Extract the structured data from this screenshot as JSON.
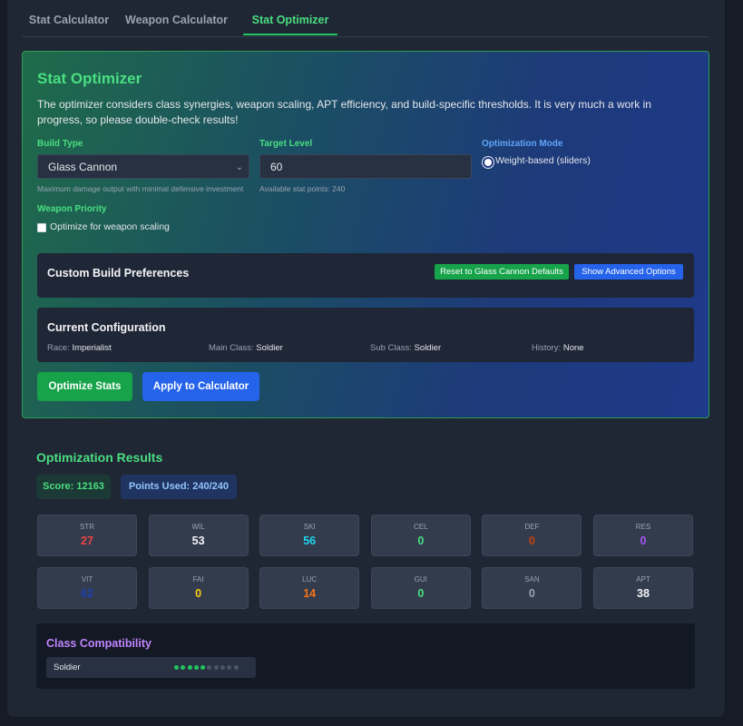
{
  "tabs": [
    {
      "label": "Stat Calculator",
      "active": false
    },
    {
      "label": "Weapon Calculator",
      "active": false
    },
    {
      "label": "Stat Optimizer",
      "active": true
    }
  ],
  "optimizer": {
    "title": "Stat Optimizer",
    "description": "The optimizer considers class synergies, weapon scaling, APT efficiency, and build-specific thresholds. It is very much a work in progress, so please double-check results!",
    "build_type": {
      "label": "Build Type",
      "value": "Glass Cannon",
      "help": "Maximum damage output with minimal defensive investment"
    },
    "target_level": {
      "label": "Target Level",
      "value": "60",
      "help": "Available stat points: 240"
    },
    "optimization_mode": {
      "label": "Optimization Mode",
      "option": "Weight-based (sliders)",
      "selected": true
    },
    "weapon_priority": {
      "label": "Weapon Priority",
      "checkbox_label": "Optimize for weapon scaling",
      "checked": false
    },
    "custom_prefs": {
      "title": "Custom Build Preferences",
      "reset_label": "Reset to Glass Cannon Defaults",
      "advanced_label": "Show Advanced Options"
    },
    "current_config": {
      "title": "Current Configuration",
      "race_label": "Race:",
      "race": "Imperialist",
      "main_label": "Main Class:",
      "main": "Soldier",
      "sub_label": "Sub Class:",
      "sub": "Soldier",
      "history_label": "History:",
      "history": "None"
    },
    "optimize_label": "Optimize Stats",
    "apply_label": "Apply to Calculator"
  },
  "results": {
    "title": "Optimization Results",
    "score": "Score: 12163",
    "points": "Points Used: 240/240",
    "stats": [
      {
        "name": "STR",
        "value": "27",
        "color": "#ef4444"
      },
      {
        "name": "WIL",
        "value": "53",
        "color": "#f3f4f6"
      },
      {
        "name": "SKI",
        "value": "56",
        "color": "#22d3ee"
      },
      {
        "name": "CEL",
        "value": "0",
        "color": "#4ade80"
      },
      {
        "name": "DEF",
        "value": "0",
        "color": "#c2410c"
      },
      {
        "name": "RES",
        "value": "0",
        "color": "#a855f7"
      },
      {
        "name": "VIT",
        "value": "62",
        "color": "#1e40af"
      },
      {
        "name": "FAI",
        "value": "0",
        "color": "#facc15"
      },
      {
        "name": "LUC",
        "value": "14",
        "color": "#f97316"
      },
      {
        "name": "GUI",
        "value": "0",
        "color": "#4ade80"
      },
      {
        "name": "SAN",
        "value": "0",
        "color": "#9ca3af"
      },
      {
        "name": "APT",
        "value": "38",
        "color": "#f3f4f6"
      }
    ]
  },
  "compatibility": {
    "title": "Class Compatibility",
    "classes": [
      {
        "name": "Soldier",
        "rating": 5,
        "max": 10
      }
    ]
  }
}
